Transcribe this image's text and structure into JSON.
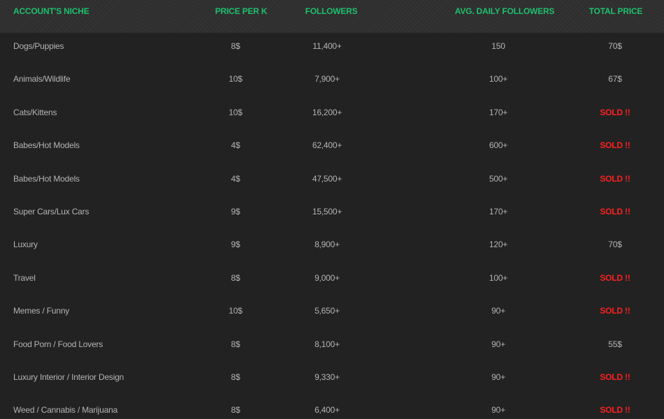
{
  "header": {
    "niche": "ACCOUNT'S NICHE",
    "price_per_k": "PRICE PER K",
    "followers": "FOLLOWERS",
    "avg_daily": "AVG. DAILY FOLLOWERS",
    "total_price": "TOTAL PRICE"
  },
  "colors": {
    "header_text": "#1fbf6e",
    "body_text": "#b4b4b4",
    "sold": "#ff2020",
    "background": "#222222"
  },
  "rows": [
    {
      "niche": "Dogs/Puppies",
      "price_per_k": "8$",
      "followers": "11,400+",
      "avg_daily": "150",
      "total_price": "70$",
      "sold": false
    },
    {
      "niche": "Animals/Wildlife",
      "price_per_k": "10$",
      "followers": "7,900+",
      "avg_daily": "100+",
      "total_price": "67$",
      "sold": false
    },
    {
      "niche": "Cats/Kittens",
      "price_per_k": "10$",
      "followers": "16,200+",
      "avg_daily": "170+",
      "total_price": "SOLD !!",
      "sold": true
    },
    {
      "niche": "Babes/Hot Models",
      "price_per_k": "4$",
      "followers": "62,400+",
      "avg_daily": "600+",
      "total_price": "SOLD !!",
      "sold": true
    },
    {
      "niche": "Babes/Hot Models",
      "price_per_k": "4$",
      "followers": "47,500+",
      "avg_daily": "500+",
      "total_price": "SOLD !!",
      "sold": true
    },
    {
      "niche": "Super Cars/Lux Cars",
      "price_per_k": "9$",
      "followers": "15,500+",
      "avg_daily": "170+",
      "total_price": "SOLD !!",
      "sold": true
    },
    {
      "niche": "Luxury",
      "price_per_k": "9$",
      "followers": "8,900+",
      "avg_daily": "120+",
      "total_price": "70$",
      "sold": false
    },
    {
      "niche": "Travel",
      "price_per_k": "8$",
      "followers": "9,000+",
      "avg_daily": "100+",
      "total_price": "SOLD !!",
      "sold": true
    },
    {
      "niche": "Memes / Funny",
      "price_per_k": "10$",
      "followers": "5,650+",
      "avg_daily": "90+",
      "total_price": "SOLD !!",
      "sold": true
    },
    {
      "niche": "Food Porn / Food Lovers",
      "price_per_k": "8$",
      "followers": "8,100+",
      "avg_daily": "90+",
      "total_price": "55$",
      "sold": false
    },
    {
      "niche": "Luxury Interior / Interior Design",
      "price_per_k": "8$",
      "followers": "9,330+",
      "avg_daily": "90+",
      "total_price": "SOLD !!",
      "sold": true
    },
    {
      "niche": "Weed / Cannabis / Marijuana",
      "price_per_k": "8$",
      "followers": "6,400+",
      "avg_daily": "90+",
      "total_price": "SOLD !!",
      "sold": true
    }
  ]
}
